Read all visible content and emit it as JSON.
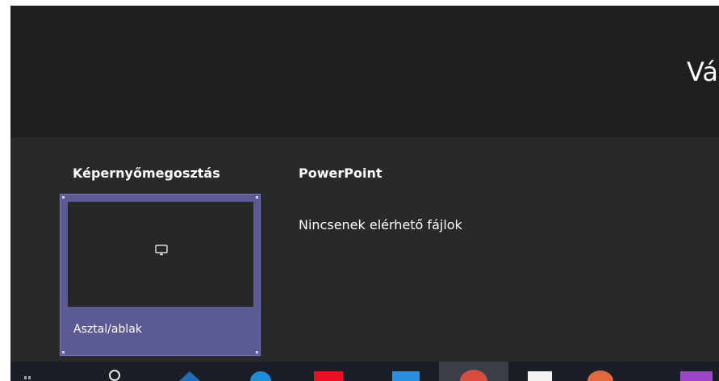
{
  "header": {
    "title": "Vá"
  },
  "sections": {
    "screen_share": {
      "heading": "Képernyőmegosztás",
      "tile": {
        "label": "Asztal/ablak",
        "icon": "monitor-icon"
      }
    },
    "powerpoint": {
      "heading": "PowerPoint",
      "empty_message": "Nincsenek elérhető fájlok"
    }
  },
  "taskbar": {
    "icons": [
      "start-icon",
      "search-icon",
      "edge-icon",
      "browser-icon",
      "app-red-icon",
      "app-blue-icon",
      "chrome-icon",
      "paint-icon",
      "powerpoint-icon",
      "onenote-icon"
    ]
  },
  "colors": {
    "background": "#1f1f1f",
    "panel": "#292929",
    "tile": "#5b5a92",
    "taskbar": "#1a1e25"
  }
}
